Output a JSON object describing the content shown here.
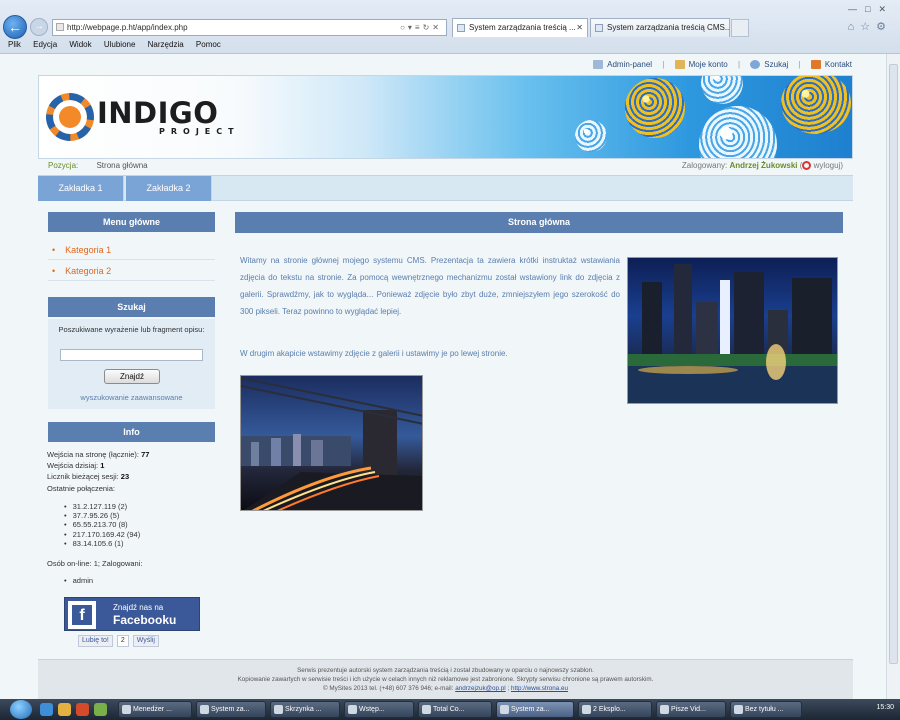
{
  "browser": {
    "url": "http://webpage.p.ht/app/index.php",
    "tabs": [
      {
        "label": "System zarządzania treścią ..."
      },
      {
        "label": "System zarządzania treścią CMS..."
      }
    ],
    "menu": [
      "Plik",
      "Edycja",
      "Widok",
      "Ulubione",
      "Narzędzia",
      "Pomoc"
    ]
  },
  "page": {
    "toplinks": [
      "Admin-panel",
      "Moje konto",
      "Szukaj",
      "Kontakt"
    ],
    "logo": {
      "title": "INDIGO",
      "subtitle": "PROJECT"
    },
    "position_label": "Pozycja:",
    "position_value": "Strona główna",
    "logged_label": "Zalogowany:",
    "logged_user": "Andrzej Żukowski",
    "logout_label": "wyloguj",
    "tabs": [
      "Zakładka 1",
      "Zakładka 2"
    ],
    "sidebar": {
      "menu_title": "Menu główne",
      "categories": [
        "Kategoria 1",
        "Kategoria 2"
      ],
      "search_title": "Szukaj",
      "search_label": "Poszukiwane wyrażenie lub fragment opisu:",
      "search_button": "Znajdź",
      "advanced_search": "wyszukowanie zaawansowane",
      "info_title": "Info",
      "visits_total_label": "Wejścia na stronę (łącznie):",
      "visits_total": "77",
      "visits_today_label": "Wejścia dzisiaj:",
      "visits_today": "1",
      "session_label": "Licznik bieżącej sesji:",
      "session_count": "23",
      "recent_label": "Ostatnie połączenia:",
      "ips": [
        "31.2.127.119 (2)",
        "37.7.95.26 (5)",
        "65.55.213.70 (8)",
        "217.170.169.42 (94)",
        "83.14.105.6 (1)"
      ],
      "online_text": "Osób on-line: 1; Zalogowani:",
      "online_users": [
        "admin"
      ],
      "fb_line1": "Znajdź nas na",
      "fb_line2": "Facebooku",
      "like_label": "Lubię to!",
      "like_count": "2",
      "share_label": "Wyślij"
    },
    "content": {
      "title": "Strona główna",
      "paragraph1": "Witamy na stronie głównej mojego systemu CMS. Prezentacja ta zawiera krótki instruktaż wstawiania zdjęcia do tekstu na stronie. Za pomocą wewnętrznego mechanizmu został wstawiony link do zdjęcia z galerii. Sprawdźmy, jak to wygląda... Ponieważ zdjęcie było zbyt duże, zmniejszyłem jego szerokość do 300 pikseli. Teraz powinno to wyglądać lepiej.",
      "paragraph2": "W drugim akapicie wstawimy zdjęcie z galerii i ustawimy je po lewej stronie."
    },
    "footer": {
      "line1": "Serwis prezentuje autorski system zarządzania treścią i został zbudowany w oparciu o najnowszy szablon.",
      "line2": "Kopiowanie zawartych w serwisie treści i ich użycie w celach innych niż reklamowe jest zabronione. Skrypty serwisu chronione są prawem autorskim.",
      "line3": "© MySites 2013 tel. (+48) 607 376 946; e-mail:",
      "email": "andrzejzuk@op.pl",
      "website": "http://www.strona.eu"
    }
  },
  "taskbar": {
    "buttons": [
      "Menedżer ...",
      "System za...",
      "Skrzynka ...",
      "Wstęp...",
      "Total Co...",
      "System za...",
      "2 Eksplo...",
      "Pisze Vid...",
      "Bez tytułu ..."
    ],
    "clock": "15:30"
  }
}
